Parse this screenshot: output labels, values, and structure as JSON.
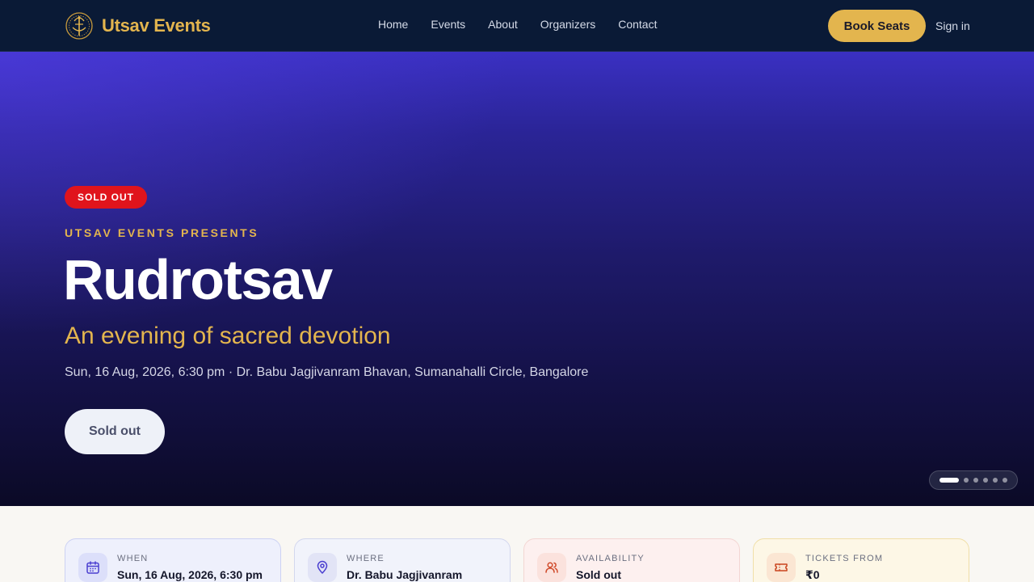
{
  "brand": {
    "name": "Utsav Events",
    "logo_icon": "lotus-emblem-icon"
  },
  "nav": {
    "links": [
      "Home",
      "Events",
      "About",
      "Organizers",
      "Contact"
    ],
    "book_label": "Book Seats",
    "signin_label": "Sign in"
  },
  "hero": {
    "status_badge": "SOLD OUT",
    "presents": "UTSAV EVENTS PRESENTS",
    "title": "Rudrotsav",
    "subtitle": "An evening of sacred devotion",
    "meta": "Sun, 16 Aug, 2026, 6:30 pm · Dr. Babu Jagjivanram Bhavan, Sumanahalli Circle, Bangalore",
    "cta_label": "Sold out",
    "carousel": {
      "slides": 6,
      "active_index": 0
    }
  },
  "info_cards": [
    {
      "label": "WHEN",
      "value": "Sun, 16 Aug, 2026, 6:30 pm",
      "icon": "calendar-icon"
    },
    {
      "label": "WHERE",
      "value": "Dr. Babu Jagjivanram",
      "icon": "map-pin-icon"
    },
    {
      "label": "AVAILABILITY",
      "value": "Sold out",
      "icon": "users-icon"
    },
    {
      "label": "TICKETS FROM",
      "value": "₹0",
      "icon": "ticket-icon"
    }
  ],
  "colors": {
    "nav_bg": "#0a1a36",
    "accent_gold": "#e3b54e",
    "sold_out_red": "#e0141c",
    "hero_top": "#3a30c2",
    "hero_bottom": "#0b0a26"
  }
}
